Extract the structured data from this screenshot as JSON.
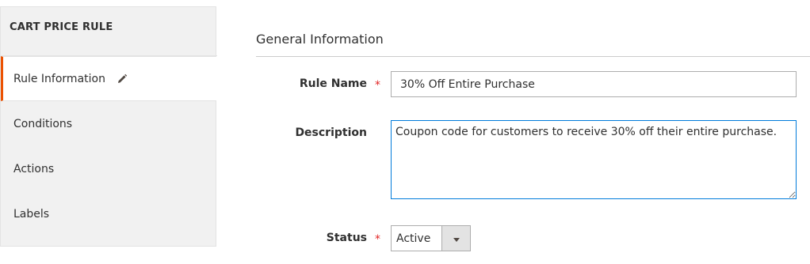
{
  "sidebar": {
    "title": "CART PRICE RULE",
    "items": [
      {
        "label": "Rule Information",
        "active": true,
        "icon": "pencil-icon"
      },
      {
        "label": "Conditions",
        "active": false
      },
      {
        "label": "Actions",
        "active": false
      },
      {
        "label": "Labels",
        "active": false
      }
    ]
  },
  "main": {
    "section_title": "General Information",
    "fields": {
      "rule_name": {
        "label": "Rule Name",
        "required": true,
        "value": "30% Off Entire Purchase"
      },
      "description": {
        "label": "Description",
        "required": false,
        "value": "Coupon code for customers to receive 30% off their entire purchase."
      },
      "status": {
        "label": "Status",
        "required": true,
        "value": "Active"
      }
    }
  },
  "colors": {
    "accent": "#eb5202",
    "required": "#e22626",
    "focus": "#007bdb"
  }
}
